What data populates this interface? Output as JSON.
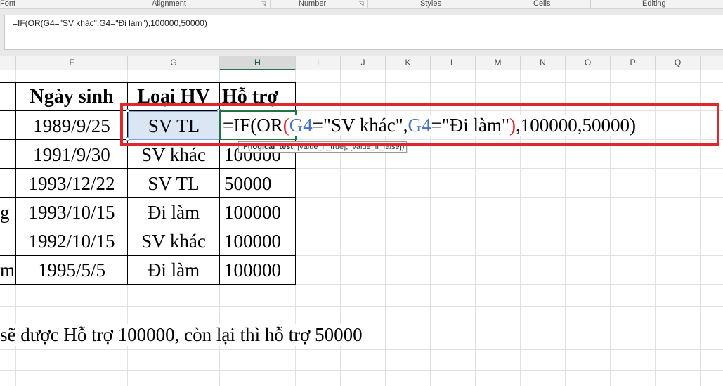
{
  "ribbon": {
    "groups": [
      "Font",
      "Alignment",
      "Number",
      "Styles",
      "Cells",
      "Editing"
    ]
  },
  "formula_bar": {
    "content": "=IF(OR(G4=\"SV khác\",G4=\"Đi làm\"),100000,50000)"
  },
  "columns": [
    "F",
    "G",
    "H",
    "I",
    "J",
    "K",
    "L",
    "M",
    "N",
    "O",
    "P",
    "Q"
  ],
  "active_column": "H",
  "table": {
    "headers": {
      "F": "Ngày sinh",
      "G": "Loại HV",
      "H": "Hỗ trợ"
    },
    "rows": [
      {
        "E": "",
        "F": "1989/9/25",
        "G": "SV TL",
        "H": ""
      },
      {
        "E": "",
        "F": "1991/9/30",
        "G": "SV khác",
        "H": "100000"
      },
      {
        "E": "",
        "F": "1993/12/22",
        "G": "SV TL",
        "H": "50000"
      },
      {
        "E": "g",
        "F": "1993/10/15",
        "G": "Đi làm",
        "H": "100000"
      },
      {
        "E": "",
        "F": "1992/10/15",
        "G": "SV khác",
        "H": "100000"
      },
      {
        "E": "m",
        "F": "1995/5/5",
        "G": "Đi làm",
        "H": "100000"
      }
    ]
  },
  "note": "sẽ được Hỗ trợ 100000, còn lại thì hỗ trợ 50000",
  "cell_edit": {
    "parts": {
      "if_open": "=IF(",
      "or_name": "OR",
      "or_open": "(",
      "ref1": "G4",
      "cond1": "=\"SV khác\",",
      "ref2": "G4",
      "cond2": "=\"Đi làm\"",
      "or_close": ")",
      "rest": ",100000,50000)"
    }
  },
  "tooltip": {
    "fn": "IF(",
    "arg1": "logical_test",
    "rest": ", [value_if_true], [value_if_false])"
  },
  "colors": {
    "ref_blue": "#4472c4",
    "paren_red": "#e0262f",
    "highlight_red": "#e0262f",
    "excel_green": "#217346",
    "selected_fill": "#dbe6f5"
  }
}
